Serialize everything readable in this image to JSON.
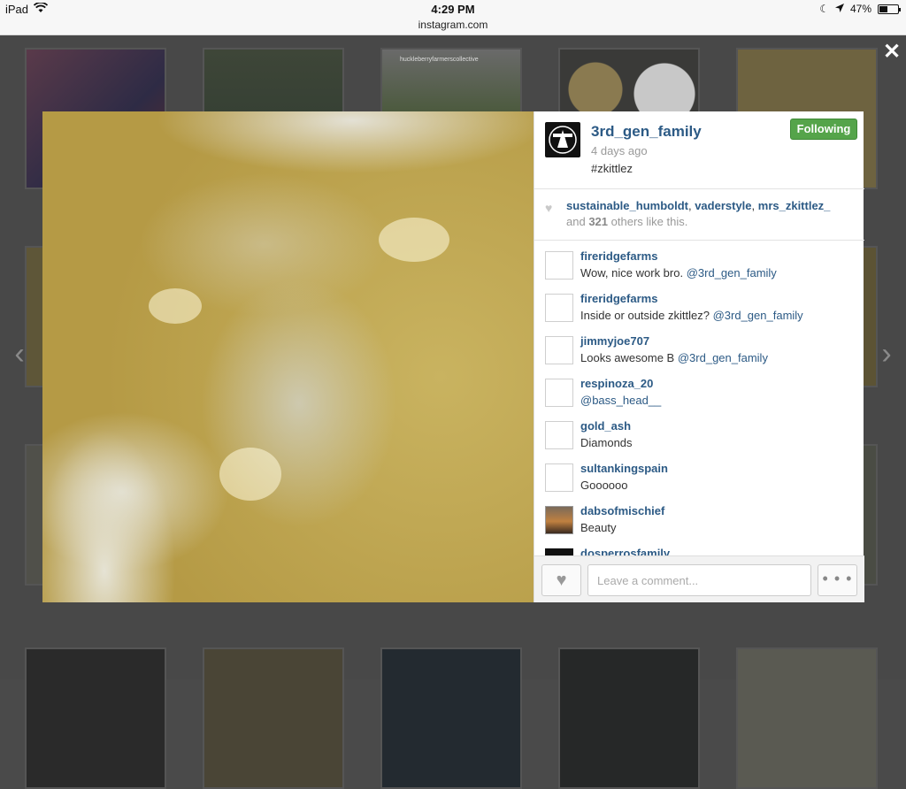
{
  "status_bar": {
    "device": "iPad",
    "time": "4:29 PM",
    "url": "instagram.com",
    "battery": "47%",
    "battery_level": 0.47
  },
  "background_tiles": {
    "tile_3_caption": "huckleberryfarmerscollective"
  },
  "post": {
    "username": "3rd_gen_family",
    "time_ago": "4 days ago",
    "caption": "#zkittlez",
    "follow_label": "Following",
    "likers": [
      "sustainable_humboldt",
      "vaderstyle",
      "mrs_zkittlez_"
    ],
    "likes_prefix": "and",
    "likes_count": "321",
    "likes_suffix": "others like this."
  },
  "comments": [
    {
      "user": "fireridgefarms",
      "text": "Wow, nice work bro.",
      "mention": "@3rd_gen_family"
    },
    {
      "user": "fireridgefarms",
      "text": "Inside or outside zkittlez?",
      "mention": "@3rd_gen_family"
    },
    {
      "user": "jimmyjoe707",
      "text": "Looks awesome B",
      "mention": "@3rd_gen_family"
    },
    {
      "user": "respinoza_20",
      "text": "",
      "mention": "@bass_head__"
    },
    {
      "user": "gold_ash",
      "text": "Diamonds",
      "mention": ""
    },
    {
      "user": "sultankingspain",
      "text": "Goooooo",
      "mention": ""
    },
    {
      "user": "dabsofmischief",
      "text": "Beauty",
      "mention": ""
    },
    {
      "user": "dosperrosfamily",
      "text": "",
      "mention": ""
    }
  ],
  "footer": {
    "comment_placeholder": "Leave a comment...",
    "more_label": "• • •"
  },
  "icons": {
    "close": "close-icon",
    "prev": "chevron-left-icon",
    "next": "chevron-right-icon",
    "heart": "heart-icon"
  }
}
